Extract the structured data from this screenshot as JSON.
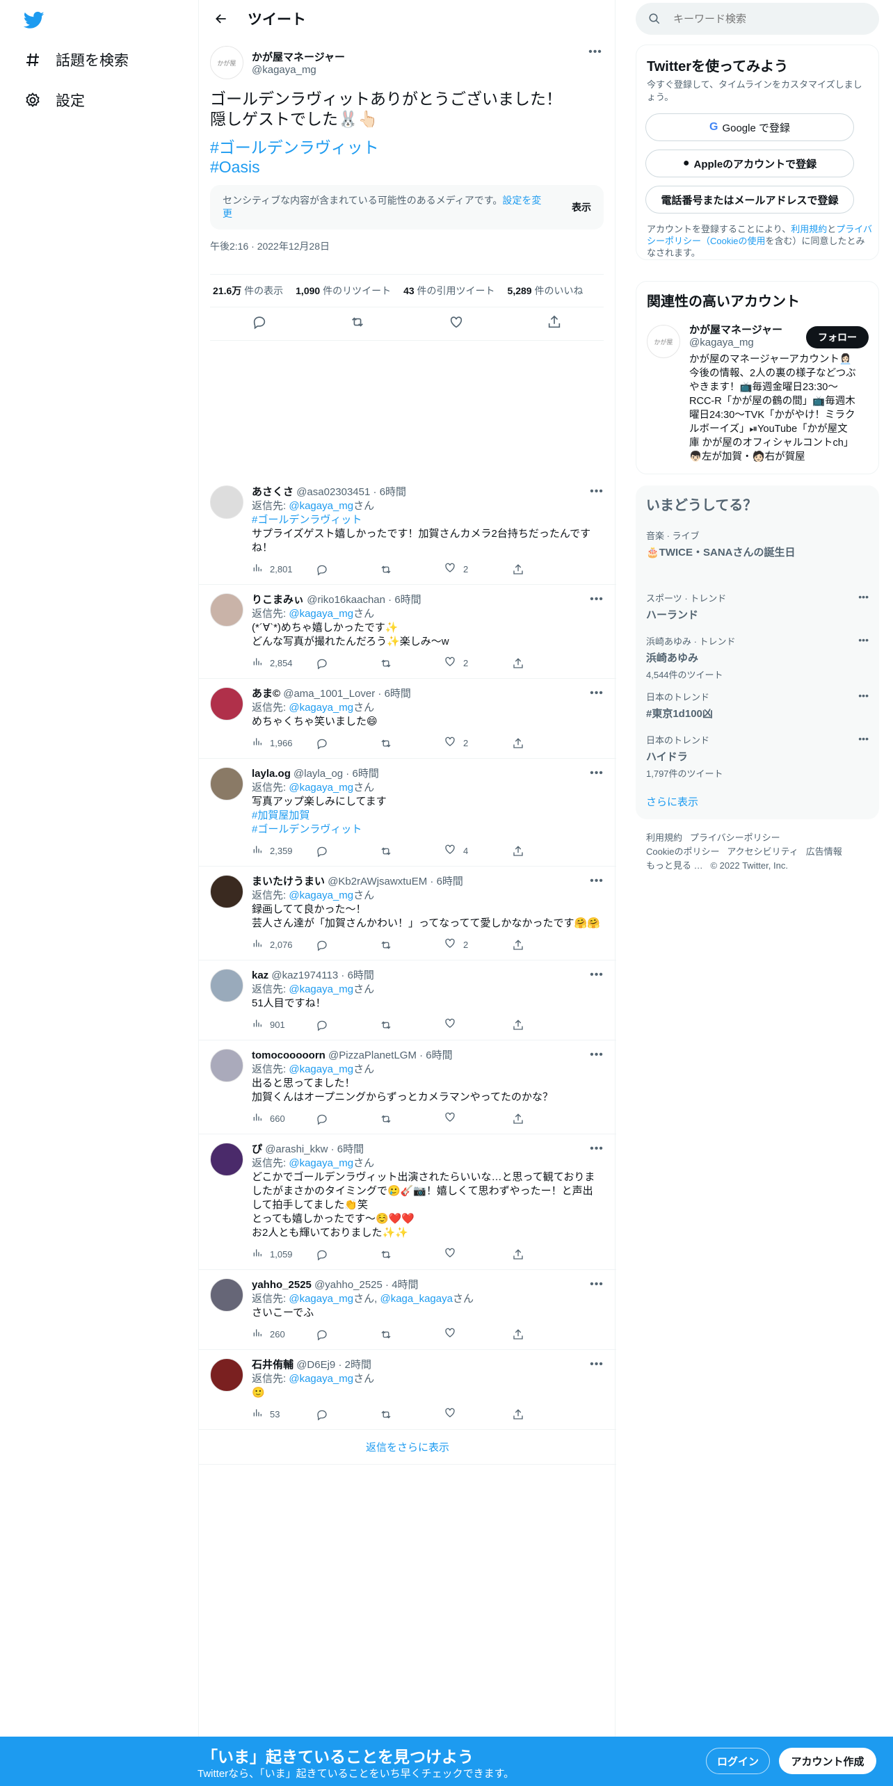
{
  "nav": {
    "items": [
      {
        "label": "話題を検索",
        "icon": "hashtag-icon"
      },
      {
        "label": "設定",
        "icon": "gear-icon"
      }
    ]
  },
  "header": {
    "title": "ツイート"
  },
  "tweet": {
    "name": "かが屋マネージャー",
    "handle": "@kagaya_mg",
    "avatar_text": "かが屋",
    "text_line1": "ゴールデンラヴィットありがとうございました！",
    "text_line2": "隠しゲストでした🐰👆🏻",
    "hashtag1": "#ゴールデンラヴィット",
    "hashtag2": "#Oasis",
    "sensitive_text": "センシティブな内容が含まれている可能性のあるメディアです。",
    "sensitive_link": "設定を変更",
    "sensitive_show": "表示",
    "timestamp": "午後2:16 · 2022年12月28日",
    "stats": [
      {
        "num": "21.6万",
        "label": " 件の表示"
      },
      {
        "num": "1,090",
        "label": " 件のリツイート"
      },
      {
        "num": "43",
        "label": " 件の引用ツイート"
      },
      {
        "num": "5,289",
        "label": " 件のいいね"
      }
    ]
  },
  "replies": [
    {
      "name": "あさくさ",
      "handle": "@asa02303451",
      "time": "6時間",
      "reply_to_label": "返信先: ",
      "reply_to": "@kagaya_mg",
      "suffix": "さん",
      "hashtag": "#ゴールデンラヴィット",
      "lines": [
        "サプライズゲスト嬉しかったです！加賀さんカメラ2台持ちだったんです",
        "ね！"
      ],
      "views": "2,801",
      "likes": "2"
    },
    {
      "name": "りこまみぃ",
      "handle": "@riko16kaachan",
      "time": "6時間",
      "reply_to_label": "返信先: ",
      "reply_to": "@kagaya_mg",
      "suffix": "さん",
      "lines": [
        "(*´∀`*)めちゃ嬉しかったです✨",
        "どんな写真が撮れたんだろう✨楽しみ〜w"
      ],
      "views": "2,854",
      "likes": "2"
    },
    {
      "name": "あま©",
      "handle": "@ama_1001_Lover",
      "time": "6時間",
      "reply_to_label": "返信先: ",
      "reply_to": "@kagaya_mg",
      "suffix": "さん",
      "lines": [
        "めちゃくちゃ笑いました😄"
      ],
      "views": "1,966",
      "likes": "2"
    },
    {
      "name": "layla.og",
      "handle": "@layla_og",
      "time": "6時間",
      "reply_to_label": "返信先: ",
      "reply_to": "@kagaya_mg",
      "suffix": "さん",
      "lines": [
        "写真アップ楽しみにしてます"
      ],
      "hashtags_after": [
        "#加賀屋加賀",
        "#ゴールデンラヴィット"
      ],
      "views": "2,359",
      "likes": "4"
    },
    {
      "name": "まいたけうまい",
      "handle": "@Kb2rAWjsawxtuEM",
      "time": "6時間",
      "reply_to_label": "返信先: ",
      "reply_to": "@kagaya_mg",
      "suffix": "さん",
      "lines": [
        "録画してて良かった〜！",
        "芸人さん達が「加賀さんかわい！」ってなってて愛しかなかったです🤗🤗"
      ],
      "views": "2,076",
      "likes": "2"
    },
    {
      "name": "kaz",
      "handle": "@kaz1974113",
      "time": "6時間",
      "reply_to_label": "返信先: ",
      "reply_to": "@kagaya_mg",
      "suffix": "さん",
      "lines": [
        "51人目ですね！"
      ],
      "views": "901",
      "likes": ""
    },
    {
      "name": "tomocooooorn",
      "handle": "@PizzaPlanetLGM",
      "time": "6時間",
      "reply_to_label": "返信先: ",
      "reply_to": "@kagaya_mg",
      "suffix": "さん",
      "lines": [
        "出ると思ってました！",
        "加賀くんはオープニングからずっとカメラマンやってたのかな？"
      ],
      "views": "660",
      "likes": ""
    },
    {
      "name": "ぴ",
      "handle": "@arashi_kkw",
      "time": "6時間",
      "reply_to_label": "返信先: ",
      "reply_to": "@kagaya_mg",
      "suffix": "さん",
      "lines": [
        "どこかでゴールデンラヴィット出演されたらいいな…と思って観ておりま",
        "したがまさかのタイミングで🥲🎸📷！嬉しくて思わずやったー！と声出",
        "して拍手してました👏笑",
        "とっても嬉しかったです〜☺️❤️❤️",
        "お2人とも輝いておりました✨✨"
      ],
      "views": "1,059",
      "likes": ""
    },
    {
      "name": "yahho_2525",
      "handle": "@yahho_2525",
      "time": "4時間",
      "reply_to_label": "返信先: ",
      "reply_to": "@kagaya_mg",
      "suffix": "さん, ",
      "reply_to2": "@kaga_kagaya",
      "suffix2": "さん",
      "lines": [
        "さいこーでふ"
      ],
      "views": "260",
      "likes": ""
    },
    {
      "name": "石井侑輔",
      "handle": "@D6Ej9",
      "time": "2時間",
      "reply_to_label": "返信先: ",
      "reply_to": "@kagaya_mg",
      "suffix": "さん",
      "lines": [
        "🙂"
      ],
      "views": "53",
      "likes": ""
    }
  ],
  "show_more_replies": "返信をさらに表示",
  "search": {
    "placeholder": "キーワード検索"
  },
  "signup_card": {
    "title": "Twitterを使ってみよう",
    "subtitle": "今すぐ登録して、タイムラインをカスタマイズしましょう。",
    "google": "Google で登録",
    "apple": "Appleのアカウントで登録",
    "phone": "電話番号またはメールアドレスで登録",
    "terms_pre": "アカウントを登録することにより、",
    "terms_link1": "利用規約",
    "terms_mid": "と",
    "terms_link2": "プライバシーポリシー（Cookieの使用",
    "terms_post": "を含む）に同意したとみなされます。"
  },
  "related": {
    "title": "関連性の高いアカウント",
    "name": "かが屋マネージャー",
    "handle": "@kagaya_mg",
    "follow": "フォロー",
    "bio": [
      "かが屋のマネージャーアカウント👩🏻‍💼",
      "今後の情報、2人の裏の様子などつぶ",
      "やきます！📺毎週金曜日23:30〜",
      "RCC-R「かが屋の鶴の間」📺毎週木",
      "曜日24:30〜TVK「かがやけ！ミラク",
      "ルボーイズ」⏯YouTube「かが屋文",
      "庫 かが屋のオフィシャルコントch」",
      "👦🏻左が加賀・🧑🏻右が賀屋"
    ]
  },
  "trends": {
    "title": "いまどうしてる？",
    "items": [
      {
        "meta": "音楽 · ライブ",
        "title": "🎂TWICE・SANAさんの誕生日",
        "count": ""
      },
      {
        "meta": "スポーツ · トレンド",
        "title": "ハーランド",
        "count": ""
      },
      {
        "meta": "浜崎あゆみ · トレンド",
        "title": "浜崎あゆみ",
        "count": "4,544件のツイート"
      },
      {
        "meta": "日本のトレンド",
        "title": "#東京1d100凶",
        "count": ""
      },
      {
        "meta": "日本のトレンド",
        "title": "ハイドラ",
        "count": "1,797件のツイート"
      }
    ],
    "more": "さらに表示"
  },
  "footer": {
    "links": [
      "利用規約",
      "プライバシーポリシー",
      "Cookieのポリシー",
      "アクセシビリティ",
      "広告情報",
      "もっと見る …"
    ],
    "copyright": "© 2022 Twitter, Inc."
  },
  "banner": {
    "title": "「いま」起きていることを見つけよう",
    "subtitle": "Twitterなら、「いま」起きていることをいち早くチェックできます。",
    "login": "ログイン",
    "signup": "アカウント作成"
  },
  "colors": {
    "accent": "#1d9bf0",
    "text": "#0f1419",
    "muted": "#536471"
  }
}
